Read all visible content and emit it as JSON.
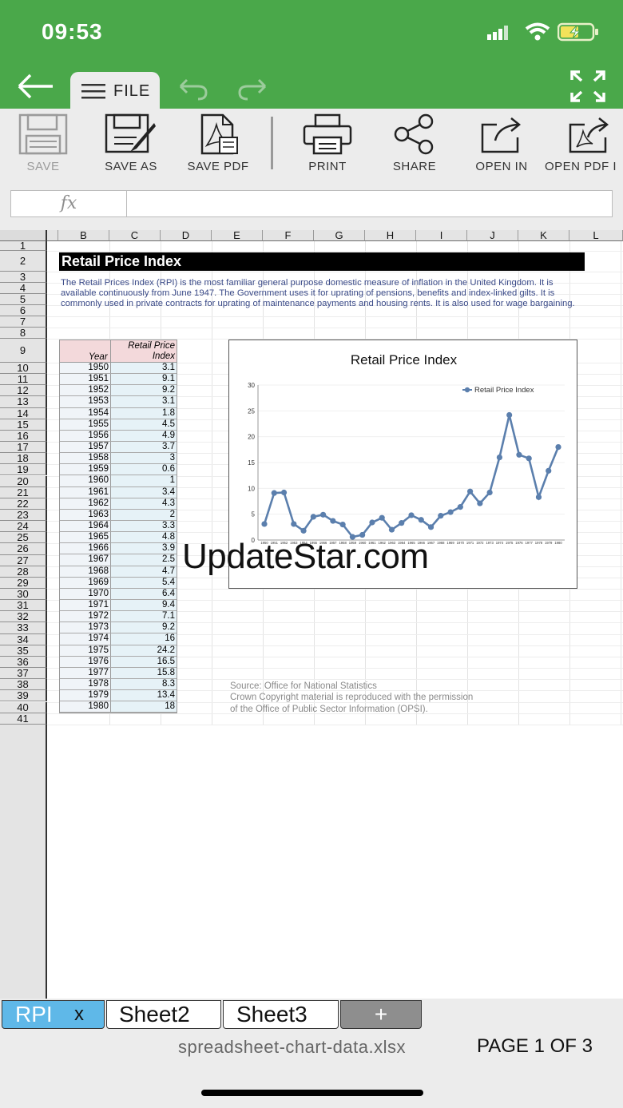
{
  "status_bar": {
    "time": "09:53"
  },
  "top_bar": {
    "file_label": "FILE"
  },
  "toolbar": {
    "save": "SAVE",
    "save_as": "SAVE AS",
    "save_pdf": "SAVE PDF",
    "print": "PRINT",
    "share": "SHARE",
    "open_in": "OPEN IN",
    "open_pdf_in": "OPEN PDF I"
  },
  "formula_bar": {
    "fx_label": "fx",
    "value": ""
  },
  "sheet": {
    "columns": [
      "B",
      "C",
      "D",
      "E",
      "F",
      "G",
      "H",
      "I",
      "J",
      "K",
      "L"
    ],
    "rows": [
      "1",
      "2",
      "3",
      "4",
      "5",
      "6",
      "7",
      "8",
      "9",
      "10",
      "11",
      "12",
      "13",
      "14",
      "15",
      "16",
      "17",
      "18",
      "19",
      "20",
      "21",
      "22",
      "23",
      "24",
      "25",
      "26",
      "27",
      "28",
      "29",
      "30",
      "31",
      "32",
      "33",
      "34",
      "35",
      "36",
      "37",
      "38",
      "39",
      "40",
      "41"
    ],
    "title": "Retail Price Index",
    "description": "The Retail Prices Index (RPI) is the most familiar general purpose domestic measure of inflation in the United Kingdom. It is available continuously from June 1947. The Government uses it for uprating of pensions, benefits and index-linked gilts. It is commonly used in private contracts for uprating of maintenance payments and housing rents. It is also used for wage bargaining.",
    "table": {
      "header_year": "Year",
      "header_index_line1": "Retail Price",
      "header_index_line2": "Index",
      "rows": [
        [
          "1950",
          "3.1"
        ],
        [
          "1951",
          "9.1"
        ],
        [
          "1952",
          "9.2"
        ],
        [
          "1953",
          "3.1"
        ],
        [
          "1954",
          "1.8"
        ],
        [
          "1955",
          "4.5"
        ],
        [
          "1956",
          "4.9"
        ],
        [
          "1957",
          "3.7"
        ],
        [
          "1958",
          "3"
        ],
        [
          "1959",
          "0.6"
        ],
        [
          "1960",
          "1"
        ],
        [
          "1961",
          "3.4"
        ],
        [
          "1962",
          "4.3"
        ],
        [
          "1963",
          "2"
        ],
        [
          "1964",
          "3.3"
        ],
        [
          "1965",
          "4.8"
        ],
        [
          "1966",
          "3.9"
        ],
        [
          "1967",
          "2.5"
        ],
        [
          "1968",
          "4.7"
        ],
        [
          "1969",
          "5.4"
        ],
        [
          "1970",
          "6.4"
        ],
        [
          "1971",
          "9.4"
        ],
        [
          "1972",
          "7.1"
        ],
        [
          "1973",
          "9.2"
        ],
        [
          "1974",
          "16"
        ],
        [
          "1975",
          "24.2"
        ],
        [
          "1976",
          "16.5"
        ],
        [
          "1977",
          "15.8"
        ],
        [
          "1978",
          "8.3"
        ],
        [
          "1979",
          "13.4"
        ],
        [
          "1980",
          "18"
        ]
      ]
    },
    "source_line1": "Source: Office for National Statistics",
    "source_line2": "Crown Copyright material is reproduced with the permission",
    "source_line3": "of the Office of Public Sector Information (OPSI)."
  },
  "chart_data": {
    "type": "line",
    "title": "Retail Price Index",
    "xlabel": "",
    "ylabel": "",
    "ylim": [
      0,
      30
    ],
    "yticks": [
      0,
      5,
      10,
      15,
      20,
      25,
      30
    ],
    "legend_position": "top-right",
    "x": [
      "1950",
      "1951",
      "1952",
      "1953",
      "1954",
      "1955",
      "1956",
      "1957",
      "1958",
      "1959",
      "1960",
      "1961",
      "1962",
      "1963",
      "1964",
      "1965",
      "1966",
      "1967",
      "1968",
      "1969",
      "1970",
      "1971",
      "1972",
      "1973",
      "1974",
      "1975",
      "1976",
      "1977",
      "1978",
      "1979",
      "1980"
    ],
    "series": [
      {
        "name": "Retail Price Index",
        "color": "#5b7fad",
        "values": [
          3.1,
          9.1,
          9.2,
          3.1,
          1.8,
          4.5,
          4.9,
          3.7,
          3,
          0.6,
          1,
          3.4,
          4.3,
          2,
          3.3,
          4.8,
          3.9,
          2.5,
          4.7,
          5.4,
          6.4,
          9.4,
          7.1,
          9.2,
          16,
          24.2,
          16.5,
          15.8,
          8.3,
          13.4,
          18
        ]
      }
    ]
  },
  "watermark": "UpdateStar.com",
  "sheet_tabs": [
    {
      "label": "RPI",
      "close": "x"
    },
    {
      "label": "Sheet2"
    },
    {
      "label": "Sheet3"
    },
    {
      "label": "+"
    }
  ],
  "footer": {
    "filename": "spreadsheet-chart-data.xlsx",
    "page_info": "PAGE 1 OF 3"
  }
}
